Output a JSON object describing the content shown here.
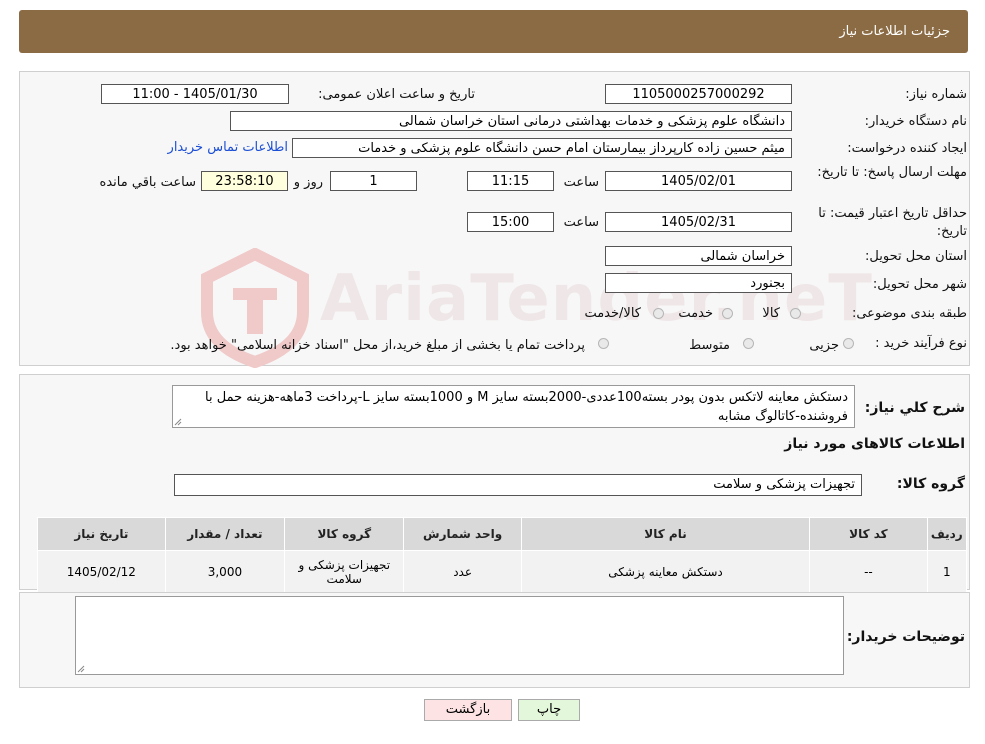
{
  "header": {
    "title": "جزئیات اطلاعات نیاز"
  },
  "form": {
    "need_number": {
      "label": "شماره نیاز:",
      "value": "1105000257000292"
    },
    "announce_datetime": {
      "label": "تاریخ و ساعت اعلان عمومی:",
      "value": "1405/01/30 - 11:00"
    },
    "buyer_org": {
      "label": "نام دستگاه خریدار:",
      "value": "دانشگاه علوم پزشکی و خدمات بهداشتی درمانی استان خراسان شمالی"
    },
    "requester": {
      "label": "ایجاد کننده درخواست:",
      "value": "میثم  حسین زاده  کارپرداز بیمارستان امام حسن دانشگاه علوم پزشکی و خدمات",
      "contact_link": "اطلاعات تماس خریدار"
    },
    "send_deadline": {
      "label": "مهلت ارسال پاسخ: تا تاریخ:",
      "date": "1405/02/01",
      "time_label": "ساعت",
      "time": "11:15",
      "days": "1",
      "days_label": "روز و",
      "remaining": "23:58:10",
      "remaining_label": "ساعت باقي مانده"
    },
    "price_validity": {
      "label": "حداقل تاریخ اعتبار قیمت: تا تاریخ:",
      "date": "1405/02/31",
      "time_label": "ساعت",
      "time": "15:00"
    },
    "province": {
      "label": "استان محل تحویل:",
      "value": "خراسان شمالی"
    },
    "city": {
      "label": "شهر محل تحویل:",
      "value": "بجنورد"
    },
    "category": {
      "label": "طبقه بندی موضوعی:",
      "options": [
        "کالا",
        "خدمت",
        "کالا/خدمت"
      ]
    },
    "purchase_type": {
      "label": "نوع فرآیند خرید :",
      "options": [
        "جزیی",
        "متوسط"
      ],
      "note": "پرداخت تمام یا بخشی از مبلغ خرید،از محل \"اسناد خزانه اسلامی\" خواهد بود."
    }
  },
  "description": {
    "label": "شرح کلي نياز:",
    "text": "دستکش معاینه لاتکس بدون پودر بسته100عددی-2000بسته سایز M و 1000بسته سایز L-پرداخت 3ماهه-هزینه حمل با فروشنده-کاتالوگ مشابه"
  },
  "goods_section": {
    "title": "اطلاعات کالاهای مورد نیاز",
    "group_label": "گروه کالا:",
    "group_value": "تجهیزات پزشکی و سلامت"
  },
  "table": {
    "headers": [
      "ردیف",
      "کد کالا",
      "نام کالا",
      "واحد شمارش",
      "گروه کالا",
      "تعداد / مقدار",
      "تاریخ نیاز"
    ],
    "rows": [
      [
        "1",
        "--",
        "دستکش معاینه پزشکی",
        "عدد",
        "تجهیزات پزشکی و سلامت",
        "3,000",
        "1405/02/12"
      ]
    ]
  },
  "buyer_notes": {
    "label": "توضیحات خریدار:",
    "value": ""
  },
  "buttons": {
    "print": "چاپ",
    "back": "بازگشت"
  },
  "colors": {
    "header_bg": "#8b6b43",
    "link": "#1c4fd6",
    "back_bg": "#fde3e3",
    "print_bg": "#e3f7da"
  },
  "watermark": "AriaTender.neT"
}
